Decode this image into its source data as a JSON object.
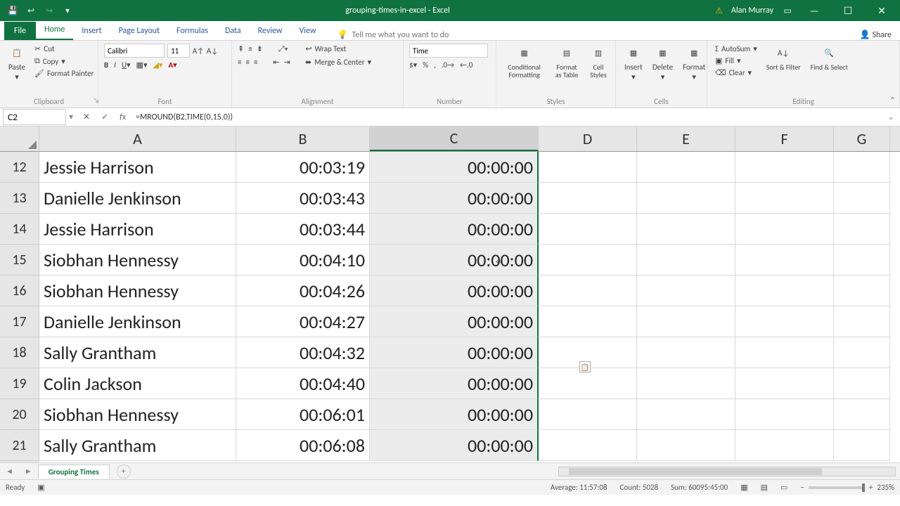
{
  "titlebar": {
    "title": "grouping-times-in-excel - Excel",
    "user": "Alan Murray"
  },
  "tabs": {
    "file": "File",
    "home": "Home",
    "insert": "Insert",
    "pagelayout": "Page Layout",
    "formulas": "Formulas",
    "data": "Data",
    "review": "Review",
    "view": "View",
    "tellme": "Tell me what you want to do",
    "share": "Share"
  },
  "ribbon": {
    "clipboard": {
      "label": "Clipboard",
      "paste": "Paste",
      "cut": "Cut",
      "copy": "Copy",
      "painter": "Format Painter"
    },
    "font": {
      "label": "Font",
      "name": "Calibri",
      "size": "11"
    },
    "alignment": {
      "label": "Alignment",
      "wrap": "Wrap Text",
      "merge": "Merge & Center"
    },
    "number": {
      "label": "Number",
      "format": "Time"
    },
    "styles": {
      "label": "Styles",
      "cond": "Conditional Formatting",
      "table": "Format as Table",
      "cell": "Cell Styles"
    },
    "cells": {
      "label": "Cells",
      "insert": "Insert",
      "delete": "Delete",
      "format": "Format"
    },
    "editing": {
      "label": "Editing",
      "autosum": "AutoSum",
      "fill": "Fill",
      "clear": "Clear",
      "sort": "Sort & Filter",
      "find": "Find & Select"
    }
  },
  "formula_bar": {
    "namebox": "C2",
    "formula": "=MROUND(B2,TIME(0,15,0))"
  },
  "columns": [
    "A",
    "B",
    "C",
    "D",
    "E",
    "F",
    "G"
  ],
  "rows": [
    {
      "n": 12,
      "a": "Jessie Harrison",
      "b": "00:03:19",
      "c": "00:00:00"
    },
    {
      "n": 13,
      "a": "Danielle Jenkinson",
      "b": "00:03:43",
      "c": "00:00:00"
    },
    {
      "n": 14,
      "a": "Jessie Harrison",
      "b": "00:03:44",
      "c": "00:00:00"
    },
    {
      "n": 15,
      "a": "Siobhan Hennessy",
      "b": "00:04:10",
      "c": "00:00:00"
    },
    {
      "n": 16,
      "a": "Siobhan Hennessy",
      "b": "00:04:26",
      "c": "00:00:00"
    },
    {
      "n": 17,
      "a": "Danielle Jenkinson",
      "b": "00:04:27",
      "c": "00:00:00"
    },
    {
      "n": 18,
      "a": "Sally Grantham",
      "b": "00:04:32",
      "c": "00:00:00"
    },
    {
      "n": 19,
      "a": "Colin Jackson",
      "b": "00:04:40",
      "c": "00:00:00"
    },
    {
      "n": 20,
      "a": "Siobhan Hennessy",
      "b": "00:06:01",
      "c": "00:00:00"
    },
    {
      "n": 21,
      "a": "Sally Grantham",
      "b": "00:06:08",
      "c": "00:00:00"
    }
  ],
  "sheet_tab": "Grouping Times",
  "status": {
    "ready": "Ready",
    "avg": "Average: 11:57:08",
    "count": "Count: 5028",
    "sum": "Sum: 60095:45:00",
    "zoom": "235%"
  }
}
